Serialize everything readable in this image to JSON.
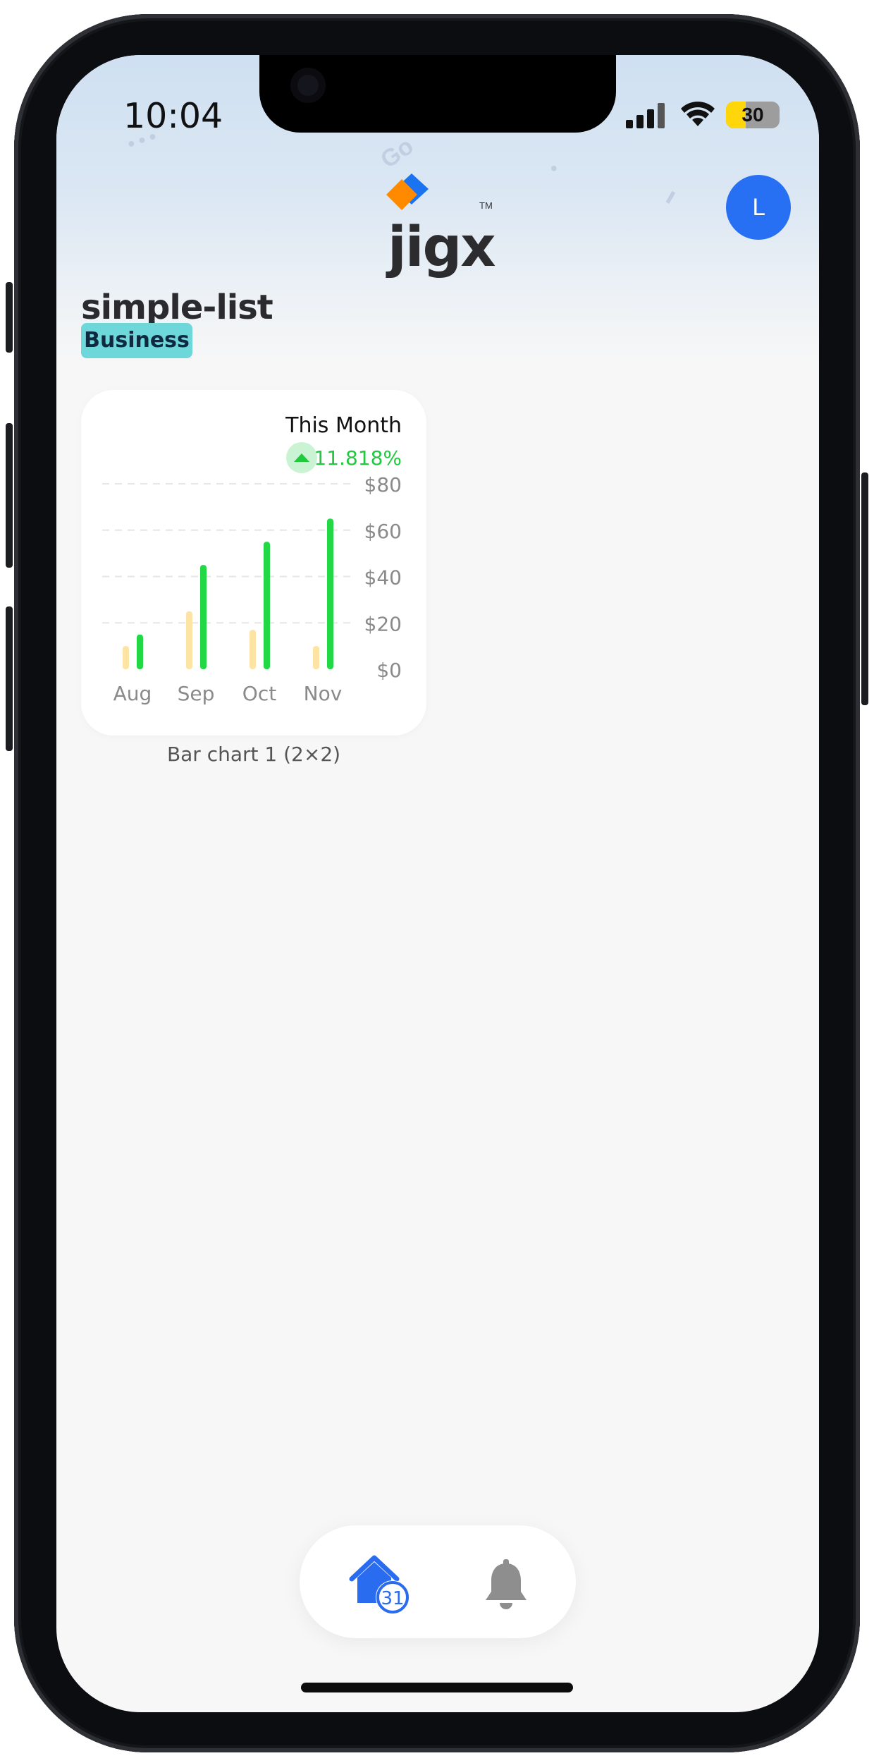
{
  "status_bar": {
    "time": "10:04",
    "battery": "30"
  },
  "header": {
    "logo_text": "jigx",
    "trademark": "TM",
    "avatar_initial": "L"
  },
  "page": {
    "title": "simple-list",
    "tag": "Business"
  },
  "widget": {
    "caption": "Bar chart 1 (2×2)",
    "headline": "This Month",
    "change": "11.818%",
    "colors": {
      "previous": "#fde3a4",
      "current": "#22d845",
      "change": "#1fca3d"
    }
  },
  "chart_data": {
    "type": "bar",
    "categories": [
      "Aug",
      "Sep",
      "Oct",
      "Nov"
    ],
    "series": [
      {
        "values": [
          10,
          25,
          17,
          10
        ]
      },
      {
        "values": [
          15,
          45,
          55,
          65
        ]
      }
    ],
    "ylim": [
      0,
      80
    ],
    "yticks": [
      "$80",
      "$60",
      "$40",
      "$20",
      "$0"
    ],
    "grid": true
  },
  "tabbar": {
    "home_badge": "31"
  }
}
